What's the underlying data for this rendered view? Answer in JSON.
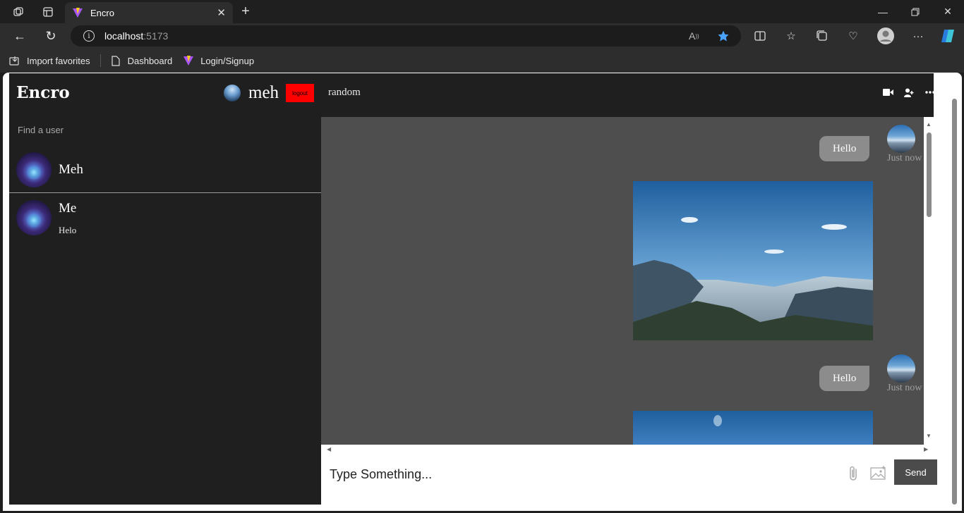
{
  "browser": {
    "tab_title": "Encro",
    "url_host": "localhost",
    "url_port": ":5173",
    "bookmarks": [
      "Import favorites",
      "Dashboard",
      "Login/Signup"
    ]
  },
  "app": {
    "brand": "Encro",
    "current_user": "meh",
    "logout_label": "logout",
    "search_placeholder": "Find a user",
    "search_result": {
      "name": "Meh"
    },
    "chats": [
      {
        "name": "Me",
        "last_message": "Helo"
      }
    ]
  },
  "chat": {
    "title": "random",
    "messages": [
      {
        "text": "Hello",
        "timestamp": "Just now"
      },
      {
        "text": "Hello",
        "timestamp": "Just now"
      }
    ],
    "input_placeholder": "Type Something...",
    "send_label": "Send"
  }
}
